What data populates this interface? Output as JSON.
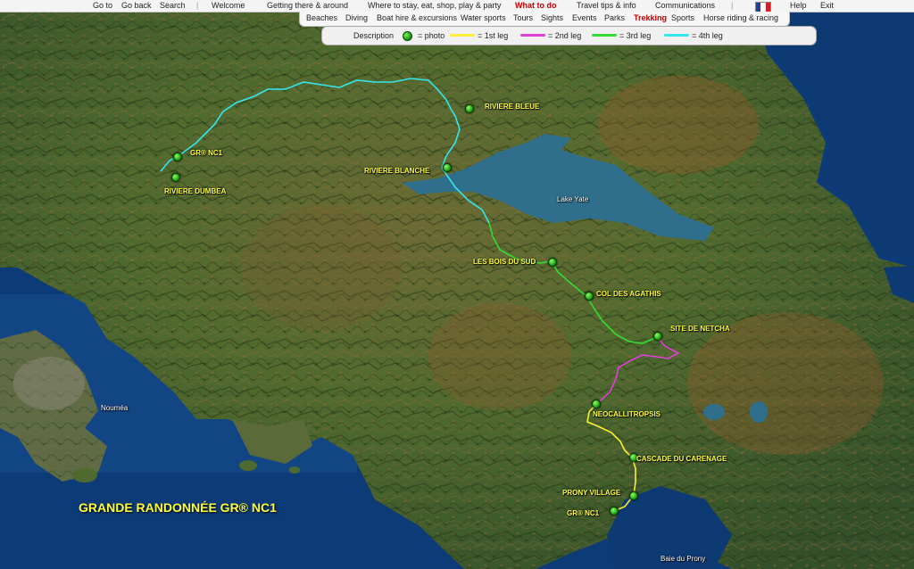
{
  "top_menu": {
    "items": [
      "Go to",
      "Go back",
      "Search",
      "Welcome",
      "Getting there & around",
      "Where to stay, eat, shop, play & party",
      "What to do",
      "Travel tips & info",
      "Communications",
      "Help",
      "Exit"
    ],
    "separator": "|",
    "active": "What to do"
  },
  "sub_menu": {
    "items": [
      "Beaches",
      "Diving",
      "Boat hire & excursions",
      "Water sports",
      "Tours",
      "Sights",
      "Events",
      "Parks",
      "Trekking",
      "Sports",
      "Horse riding & racing"
    ],
    "active": "Trekking"
  },
  "legend": {
    "description_label": "Description",
    "photo_label": "= photo",
    "legs": [
      {
        "label": "= 1st leg",
        "color": "#ffee33"
      },
      {
        "label": "= 2nd leg",
        "color": "#e040d8"
      },
      {
        "label": "= 3rd leg",
        "color": "#33dd33"
      },
      {
        "label": "= 4th leg",
        "color": "#33e6f0"
      }
    ]
  },
  "language_flag": {
    "icon": "french-flag-icon",
    "colors": [
      "#1f3fa0",
      "#ffffff",
      "#d21f2a"
    ]
  },
  "map": {
    "title": "GRANDE RANDONNÉE GR® NC1",
    "places": {
      "gr_nc1_north": "GR® NC1",
      "riviere_dumbea": "RIVIERE DUMBEA",
      "riviere_bleue": "RIVIERE BLEUE",
      "riviere_blanche": "RIVIERE BLANCHE",
      "lake_yate": "Lake Yate",
      "les_bois_du_sud": "LES BOIS DU SUD",
      "col_des_agathis": "COL DES AGATHIS",
      "site_de_netcha": "SITE DE NETCHA",
      "noumea": "Nouméa",
      "neocallitropsis": "NEOCALLITROPSIS",
      "cascade_du_carenage": "CASCADE DU CARENAGE",
      "prony_village": "PRONY VILLAGE",
      "gr_nc1_south": "GR® NC1",
      "baie_du_prony": "Baie du Prony"
    },
    "colors": {
      "sea": "#0d3b78",
      "land": "#4e6a30",
      "lake": "#2f6f8c",
      "label": "#ffff3a"
    }
  }
}
